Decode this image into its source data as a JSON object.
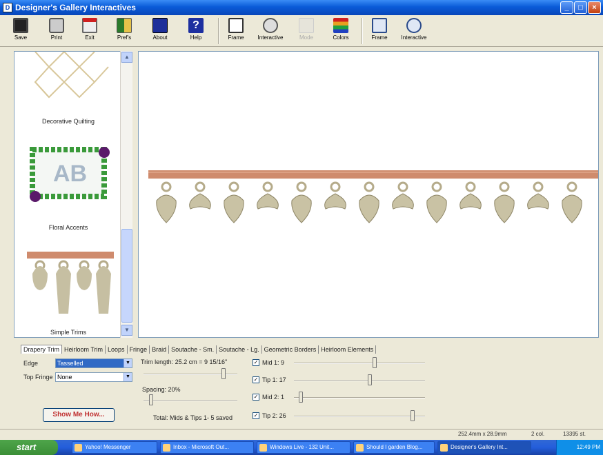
{
  "window": {
    "title": "Designer's Gallery Interactives",
    "app_icon": "designers-gallery-icon"
  },
  "toolbar": {
    "buttons": [
      {
        "label": "Save",
        "icon": "floppy-disk-icon"
      },
      {
        "label": "Print",
        "icon": "printer-icon"
      },
      {
        "label": "Exit",
        "icon": "exit-door-icon"
      },
      {
        "label": "Pref's",
        "icon": "preferences-icon"
      },
      {
        "label": "About",
        "icon": "about-icon"
      },
      {
        "label": "Help",
        "icon": "help-icon"
      },
      {
        "label": "Frame",
        "icon": "frame-icon"
      },
      {
        "label": "Interactive",
        "icon": "globe-icon"
      },
      {
        "label": "Mode",
        "icon": "mode-icon"
      },
      {
        "label": "Colors",
        "icon": "colors-icon"
      },
      {
        "label": "Frame",
        "icon": "frame-sample-icon"
      },
      {
        "label": "Interactive",
        "icon": "interactive-circle-icon"
      }
    ]
  },
  "gallery": {
    "items": [
      {
        "caption": "Decorative Quilting"
      },
      {
        "caption": "Floral Accents"
      },
      {
        "caption": "Simple Trims"
      }
    ]
  },
  "tabs": [
    "Drapery Trim",
    "Heirloom Trim",
    "Loops",
    "Fringe",
    "Braid",
    "Soutache - Sm.",
    "Soutache - Lg.",
    "Geometric Borders",
    "Heirloom Elements"
  ],
  "controls": {
    "edge_label": "Edge",
    "edge_value": "Tasselled",
    "top_fringe_label": "Top Fringe",
    "top_fringe_value": "None",
    "trim_length_label": "Trim length: 25.2 cm = 9 15/16\"",
    "spacing_label": "Spacing: 20%",
    "total_label": "Total: Mids & Tips 1- 5 saved",
    "checks": [
      {
        "label": "Mid 1: 9",
        "checked": true,
        "level": 0.62
      },
      {
        "label": "Tip 1: 17",
        "checked": true,
        "level": 0.58
      },
      {
        "label": "Mid 2: 1",
        "checked": true,
        "level": 0.04
      },
      {
        "label": "Tip 2: 26",
        "checked": true,
        "level": 0.92
      }
    ],
    "trim_length_level": 0.87,
    "spacing_level": 0.06,
    "show_me_label": "Show Me How..."
  },
  "status": {
    "size": "252.4mm x 28.9mm",
    "colors": "2 col.",
    "stitches": "13395 st."
  },
  "taskbar": {
    "start_label": "start",
    "tasks": [
      {
        "label": "Yahoo! Messenger"
      },
      {
        "label": "Inbox - Microsoft Out..."
      },
      {
        "label": "Windows Live - 132 Unit..."
      },
      {
        "label": "Should I garden Blog..."
      },
      {
        "label": "Designer's Gallery Int..."
      }
    ],
    "clock": "12:49 PM"
  },
  "colors": {
    "trim_band": "#cf8b6d",
    "tassel": "#b5ab8a",
    "leaf": "#3a9a3a",
    "flower": "#5a1a6a"
  }
}
